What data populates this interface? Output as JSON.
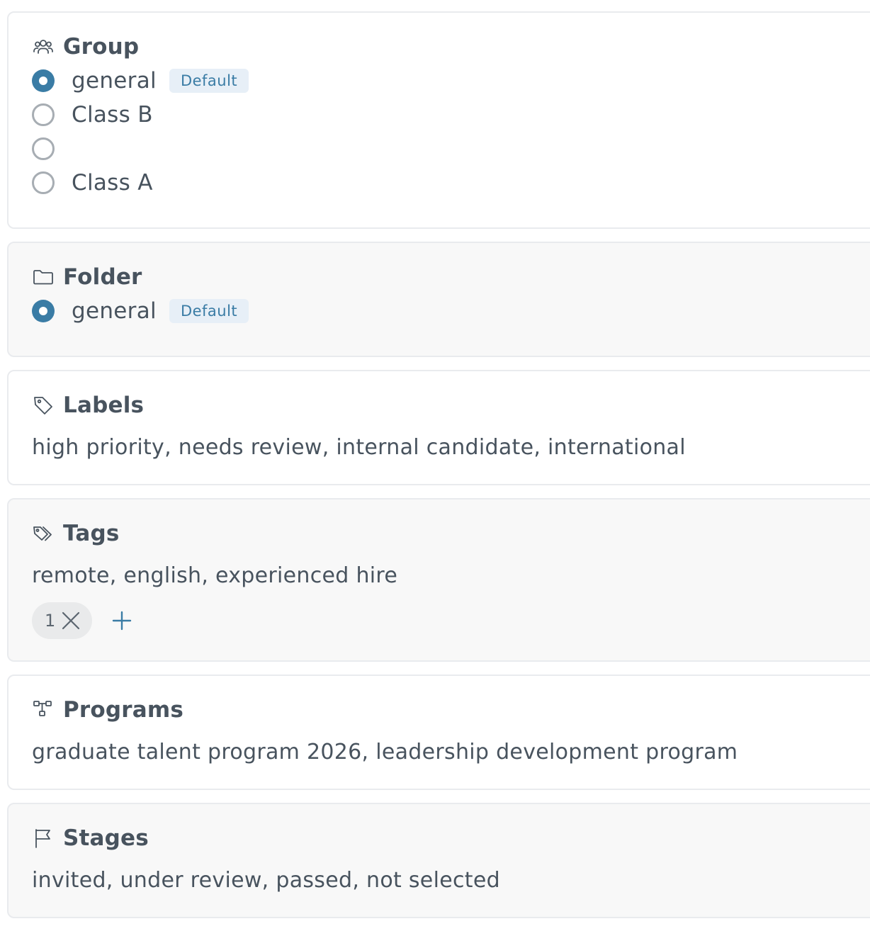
{
  "group": {
    "title": "Group",
    "icon": "users-icon",
    "options": [
      {
        "label": "general",
        "checked": true,
        "badge": "Default"
      },
      {
        "label": "Class B",
        "checked": false,
        "badge": ""
      },
      {
        "label": "",
        "checked": false,
        "badge": ""
      },
      {
        "label": "Class A",
        "checked": false,
        "badge": ""
      }
    ]
  },
  "folder": {
    "title": "Folder",
    "icon": "folder-icon",
    "options": [
      {
        "label": "general",
        "checked": true,
        "badge": "Default"
      }
    ]
  },
  "labels": {
    "title": "Labels",
    "icon": "tag-icon",
    "value": "high priority, needs review, internal candidate, international"
  },
  "tags": {
    "title": "Tags",
    "icon": "tags-icon",
    "value": "remote, english, experienced hire",
    "chip_label": "1"
  },
  "programs": {
    "title": "Programs",
    "icon": "hierarchy-icon",
    "value": "graduate talent program 2026, leadership development program"
  },
  "stages": {
    "title": "Stages",
    "icon": "flag-icon",
    "value": "invited, under review, passed, not selected"
  },
  "colors": {
    "accent": "#3a7ca5",
    "badge_bg": "#e7eff7",
    "text": "#48535e",
    "card_border": "#e9ebee"
  }
}
